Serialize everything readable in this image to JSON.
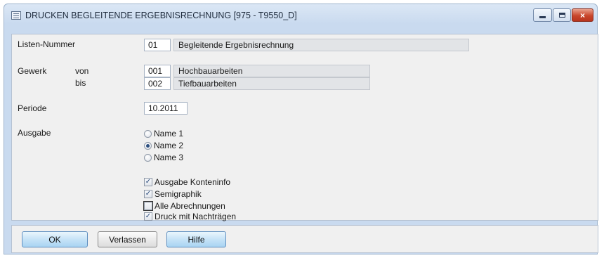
{
  "window": {
    "title": "DRUCKEN BEGLEITENDE ERGEBNISRECHNUNG [975 - T9550_D]",
    "icon": "table-icon",
    "controls": {
      "minimize": "minimize-icon",
      "maximize": "maximize-icon",
      "close": "×"
    }
  },
  "form": {
    "listen_nummer": {
      "label": "Listen-Nummer",
      "code": "01",
      "text": "Begleitende Ergebnisrechnung"
    },
    "gewerk": {
      "label": "Gewerk",
      "von": {
        "label": "von",
        "code": "001",
        "text": "Hochbauarbeiten"
      },
      "bis": {
        "label": "bis",
        "code": "002",
        "text": "Tiefbauarbeiten"
      }
    },
    "periode": {
      "label": "Periode",
      "value": "10.2011"
    },
    "ausgabe": {
      "label": "Ausgabe",
      "options": [
        {
          "label": "Name 1",
          "selected": false
        },
        {
          "label": "Name 2",
          "selected": true
        },
        {
          "label": "Name 3",
          "selected": false
        }
      ]
    },
    "checkboxes": [
      {
        "label": "Ausgabe Konteninfo",
        "checked": true
      },
      {
        "label": "Semigraphik",
        "checked": true
      },
      {
        "label": "Alle Abrechnungen",
        "checked": false
      },
      {
        "label": "Druck mit Nachträgen",
        "checked": true
      }
    ]
  },
  "buttons": {
    "ok": "OK",
    "verlassen": "Verlassen",
    "hilfe": "Hilfe"
  },
  "colors": {
    "button_blue": "#c6e3f7",
    "title_gradient": "#dbe7f5",
    "panel": "#f0f0f0"
  }
}
